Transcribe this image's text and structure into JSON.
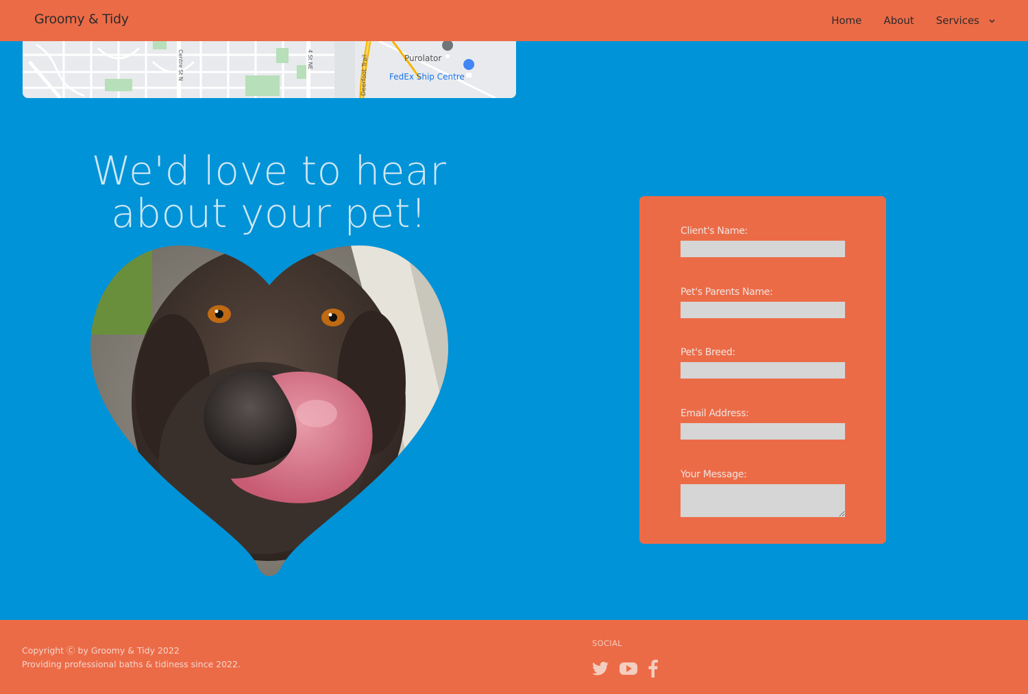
{
  "header": {
    "brand": "Groomy & Tidy",
    "nav": {
      "home": "Home",
      "about": "About",
      "services": "Services"
    }
  },
  "map": {
    "labels": [
      "Centre St N",
      "4 St NE",
      "Deerfoot Trail",
      "Purolator",
      "FedEx Ship Centre"
    ]
  },
  "hero": {
    "title": "We'd love to hear about your pet!"
  },
  "form": {
    "client_name_label": "Client's Name:",
    "parents_name_label": "Pet's Parents Name:",
    "breed_label": "Pet's Breed:",
    "email_label": "Email Address:",
    "message_label": "Your Message:"
  },
  "footer": {
    "copyright": "Copyright Ⓒ by Groomy & Tidy 2022",
    "tagline": "Providing professional baths & tidiness since 2022.",
    "social_title": "SOCIAL",
    "social_icons": [
      "twitter-icon",
      "youtube-icon",
      "facebook-icon"
    ]
  },
  "colors": {
    "accent": "#ec6b47",
    "background": "#0093d8"
  }
}
